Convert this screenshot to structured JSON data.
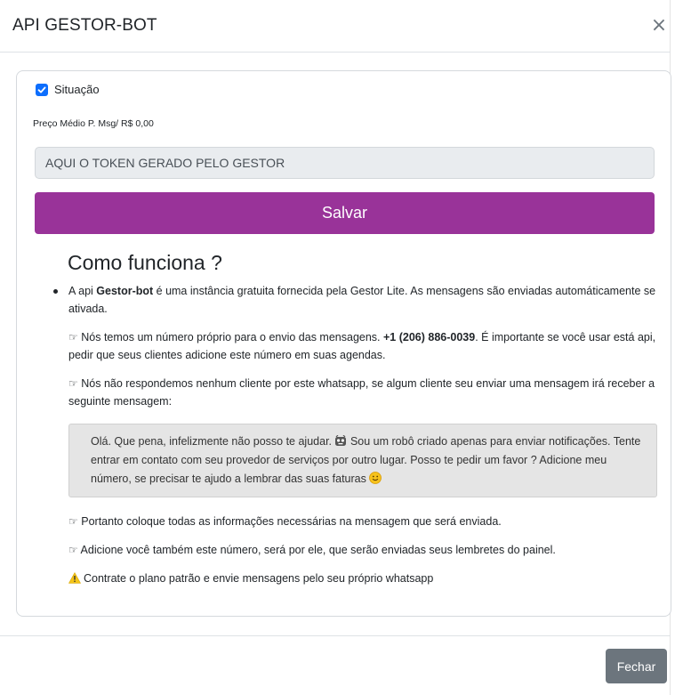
{
  "modal": {
    "title": "API GESTOR-BOT",
    "close_icon_glyph": "×"
  },
  "form": {
    "situacao_label": "Situação",
    "situacao_checked": true,
    "price_label": "Preço Médio P. Msg/ R$ 0,00",
    "token_value": "AQUI O TOKEN GERADO PELO GESTOR",
    "save_label": "Salvar",
    "save_color": "#993399"
  },
  "info": {
    "title": "Como funciona ?",
    "intro_pre": "A api ",
    "intro_bold": "Gestor-bot",
    "intro_post": " é uma instância gratuita fornecida pela Gestor Lite. As mensagens são enviadas automáticamente se ativada.",
    "hand_glyph": "☞",
    "phone_pre": " Nós temos um número próprio para o envio das mensagens. ",
    "phone_number": "+1 (206) 886-0039",
    "phone_post": ". É importante se você usar está api, pedir que seus clientes adicione este número em suas agendas.",
    "no_reply": " Nós não respondemos nenhum cliente por este whatsapp, se algum cliente seu enviar uma mensagem irá receber a seguinte mensagem:",
    "quote_pre": "Olá. Que pena, infelizmente não posso te ajudar. ",
    "quote_post": " Sou um robô criado apenas para enviar notificações. Tente entrar em contato com seu provedor de serviços por outro lugar. Posso te pedir um favor ? Adicione meu número, se precisar te ajudo a lembrar das suas faturas ",
    "tip1": " Portanto coloque todas as informações necessárias na mensagem que será enviada.",
    "tip2": " Adicione você também este número, será por ele, que serão enviadas seus lembretes do painel.",
    "warning": "Contrate o plano patrão e envie mensagens pelo seu próprio whatsapp"
  },
  "footer": {
    "close_label": "Fechar"
  },
  "colors": {
    "checkbox": "#0d6efd",
    "footer_button": "#6c757d",
    "warning": "#f5c518"
  }
}
